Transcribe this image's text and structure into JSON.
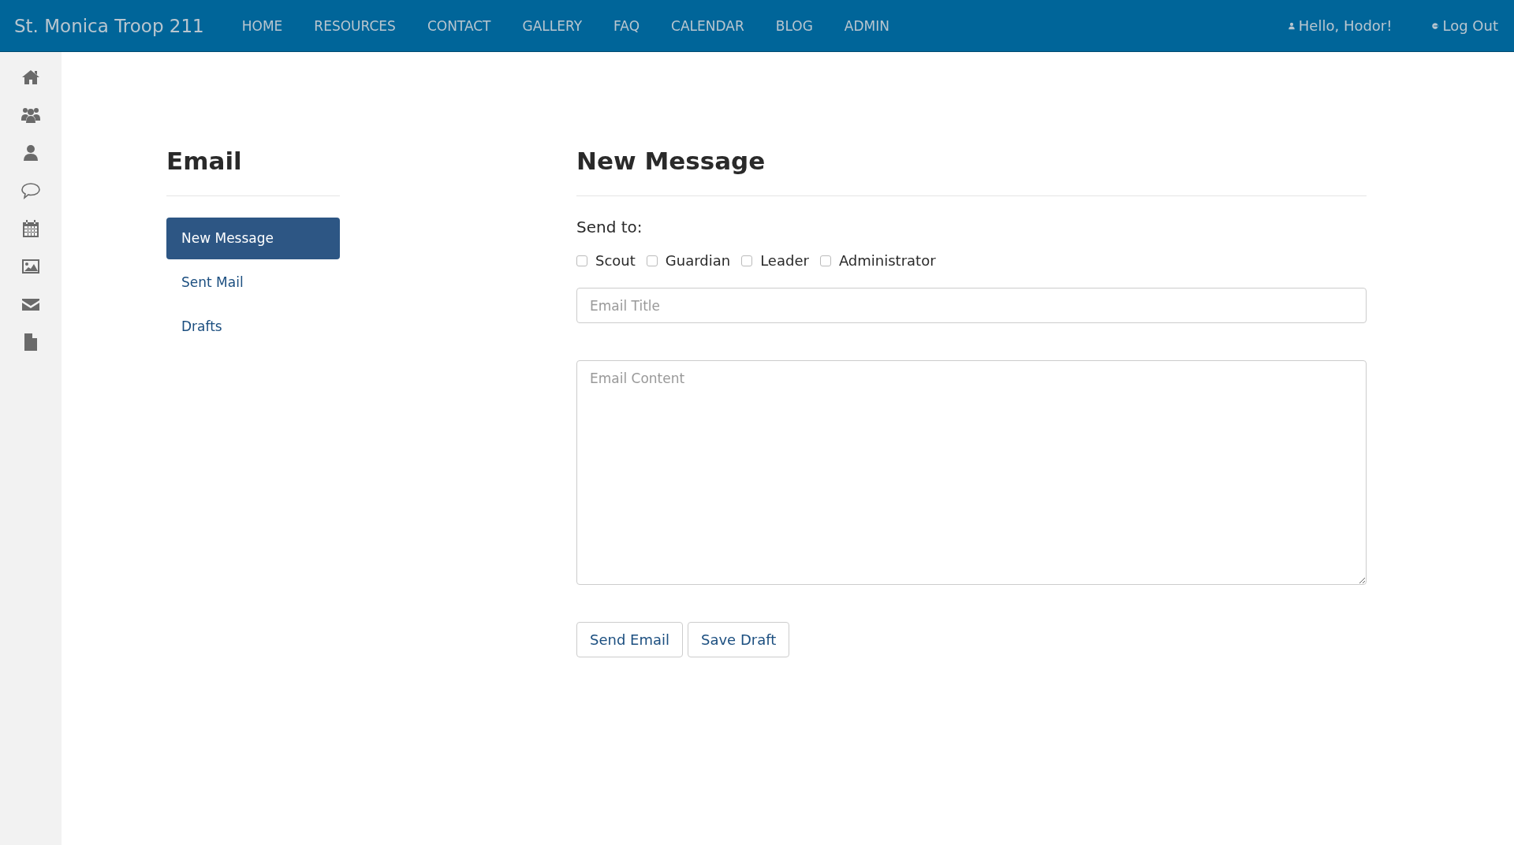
{
  "navbar": {
    "brand": "St. Monica Troop 211",
    "links": [
      {
        "label": "HOME"
      },
      {
        "label": "RESOURCES"
      },
      {
        "label": "CONTACT"
      },
      {
        "label": "GALLERY"
      },
      {
        "label": "FAQ"
      },
      {
        "label": "CALENDAR"
      },
      {
        "label": "BLOG"
      },
      {
        "label": "ADMIN"
      }
    ],
    "greeting": "Hello, Hodor!",
    "logout": "Log Out"
  },
  "sidebar": {
    "icons": [
      {
        "kind": "home"
      },
      {
        "kind": "group"
      },
      {
        "kind": "user"
      },
      {
        "kind": "chat"
      },
      {
        "kind": "calendar"
      },
      {
        "kind": "image"
      },
      {
        "kind": "mail"
      },
      {
        "kind": "file"
      }
    ]
  },
  "email_menu": {
    "title": "Email",
    "items": [
      {
        "label": "New Message",
        "selected": true
      },
      {
        "label": "Sent Mail",
        "selected": false
      },
      {
        "label": "Drafts",
        "selected": false
      }
    ]
  },
  "form": {
    "title": "New Message",
    "send_to_label": "Send to:",
    "recipients": [
      {
        "label": "Scout",
        "checked": false
      },
      {
        "label": "Guardian",
        "checked": false
      },
      {
        "label": "Leader",
        "checked": false
      },
      {
        "label": "Administrator",
        "checked": false
      }
    ],
    "title_field": {
      "placeholder": "Email Title"
    },
    "content_field": {
      "placeholder": "Email Content"
    },
    "buttons": [
      "Send Email",
      "Save Draft"
    ]
  }
}
